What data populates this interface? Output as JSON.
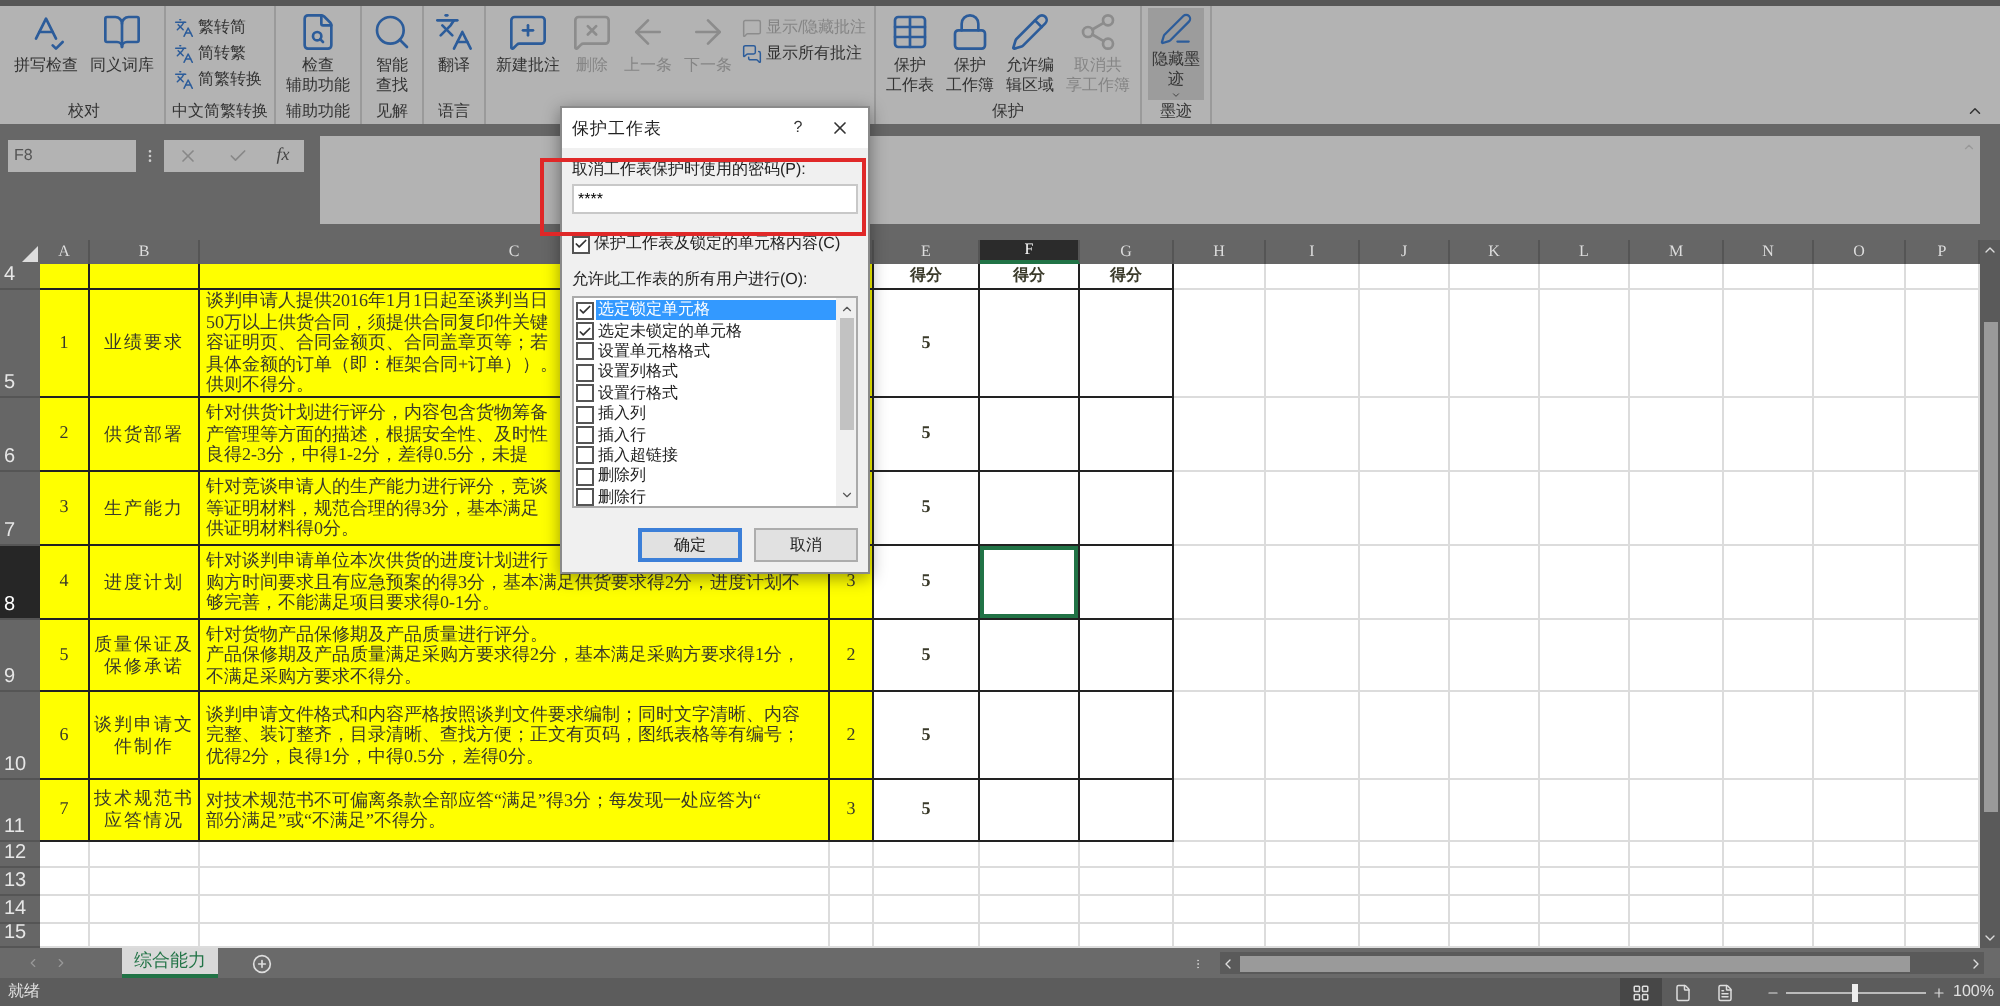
{
  "ribbon": {
    "groups": [
      {
        "label": "校对",
        "buttons": [
          {
            "lines": [
              "拼写检查"
            ],
            "kind": "large",
            "disabled": false
          },
          {
            "lines": [
              "同义词库"
            ],
            "kind": "large",
            "disabled": false
          }
        ]
      },
      {
        "label": "中文简繁转换",
        "buttons": [
          {
            "lines": [
              "繁转简"
            ],
            "kind": "small",
            "disabled": false
          },
          {
            "lines": [
              "简转繁"
            ],
            "kind": "small",
            "disabled": false
          },
          {
            "lines": [
              "简繁转换"
            ],
            "kind": "small",
            "disabled": false
          }
        ]
      },
      {
        "label": "辅助功能",
        "buttons": [
          {
            "lines": [
              "检查",
              "辅助功能"
            ],
            "kind": "large",
            "disabled": false
          }
        ]
      },
      {
        "label": "见解",
        "buttons": [
          {
            "lines": [
              "智能",
              "查找"
            ],
            "kind": "large",
            "disabled": false
          }
        ]
      },
      {
        "label": "语言",
        "buttons": [
          {
            "lines": [
              "翻译"
            ],
            "kind": "large",
            "disabled": false
          }
        ]
      },
      {
        "buttons": [
          {
            "lines": [
              "新建批注"
            ],
            "kind": "large",
            "disabled": false
          },
          {
            "lines": [
              "删除"
            ],
            "kind": "large",
            "disabled": true
          },
          {
            "lines": [
              "上一条"
            ],
            "kind": "large",
            "disabled": true
          },
          {
            "lines": [
              "下一条"
            ],
            "kind": "large",
            "disabled": true
          },
          {
            "lines": [
              "显示/隐藏批注"
            ],
            "kind": "small",
            "disabled": true
          },
          {
            "lines": [
              "显示所有批注"
            ],
            "kind": "small",
            "disabled": false
          }
        ]
      },
      {
        "label": "保护",
        "buttons": [
          {
            "lines": [
              "保护",
              "工作表"
            ],
            "kind": "large",
            "disabled": false
          },
          {
            "lines": [
              "保护",
              "工作簿"
            ],
            "kind": "large",
            "disabled": false
          },
          {
            "lines": [
              "允许编",
              "辑区域"
            ],
            "kind": "large",
            "disabled": false
          },
          {
            "lines": [
              "取消共",
              "享工作簿"
            ],
            "kind": "large",
            "disabled": true
          }
        ]
      },
      {
        "label": "墨迹",
        "buttons": [
          {
            "lines": [
              "隐藏墨",
              "迹"
            ],
            "kind": "toggle",
            "disabled": false
          }
        ]
      }
    ]
  },
  "formula_bar": {
    "name_box": "F8",
    "function_label": "fx"
  },
  "sheet": {
    "columns": [
      {
        "label": "A",
        "selected": false
      },
      {
        "label": "B",
        "selected": false
      },
      {
        "label": "C",
        "selected": false
      },
      {
        "selected": false
      },
      {
        "label": "E",
        "selected": false
      },
      {
        "label": "F",
        "selected": true
      },
      {
        "label": "G",
        "selected": false
      },
      {
        "label": "H",
        "selected": false
      },
      {
        "label": "I",
        "selected": false
      },
      {
        "label": "J",
        "selected": false
      },
      {
        "label": "K",
        "selected": false
      },
      {
        "label": "L",
        "selected": false
      },
      {
        "label": "M",
        "selected": false
      },
      {
        "label": "N",
        "selected": false
      },
      {
        "label": "O",
        "selected": false
      },
      {
        "label": "P",
        "selected": false
      }
    ],
    "rows": [
      {
        "number": "4",
        "selected": false,
        "highlighted": true,
        "cells": {
          "E": "得分",
          "F": "得分",
          "G": "得分"
        }
      },
      {
        "number": "5",
        "selected": false,
        "highlighted": true,
        "cells": {
          "A": "1",
          "B": "业绩要求",
          "C": [
            "谈判申请人提供2016年1月1日起至谈判当日",
            "50万以上供货合同，须提供合同复印件关键",
            "容证明页、合同金额页、合同盖章页等；若",
            "具体金额的订单（即：框架合同+订单））。",
            "供则不得分。"
          ],
          "E": "5"
        }
      },
      {
        "number": "6",
        "selected": false,
        "highlighted": true,
        "cells": {
          "A": "2",
          "B": "供货部署",
          "C": [
            "针对供货计划进行评分，内容包含货物筹备",
            "产管理等方面的描述，根据安全性、及时性",
            "良得2-3分，中得1-2分，差得0.5分，未提"
          ],
          "E": "5"
        }
      },
      {
        "number": "7",
        "selected": false,
        "highlighted": true,
        "cells": {
          "A": "3",
          "B": "生产能力",
          "C": [
            "针对竞谈申请人的生产能力进行评分，竞谈",
            "等证明材料，规范合理的得3分，基本满足",
            "供证明材料得0分。"
          ],
          "E": "5"
        }
      },
      {
        "number": "8",
        "selected": true,
        "highlighted": true,
        "cells": {
          "A": "4",
          "B": "进度计划",
          "C": [
            "针对谈判申请单位本次供货的进度计划进行",
            "购方时间要求且有应急预案的得3分，基本满足供货要求得2分，进度计划不",
            "够完善，不能满足项目要求得0-1分。"
          ],
          "D": "3",
          "E": "5"
        }
      },
      {
        "number": "9",
        "selected": false,
        "highlighted": true,
        "cells": {
          "A": "5",
          "B": "质量保证及保修承诺",
          "C": [
            "针对货物产品保修期及产品质量进行评分。",
            "产品保修期及产品质量满足采购方要求得2分，基本满足采购方要求得1分，",
            "不满足采购方要求不得分。"
          ],
          "D": "2",
          "E": "5"
        }
      },
      {
        "number": "10",
        "selected": false,
        "highlighted": true,
        "cells": {
          "A": "6",
          "B": "谈判申请文件制作",
          "C": [
            "谈判申请文件格式和内容严格按照谈判文件要求编制；同时文字清晰、内容",
            "完整、装订整齐，目录清晰、查找方便；正文有页码，图纸表格等有编号；",
            "优得2分，良得1分，中得0.5分，差得0分。"
          ],
          "D": "2",
          "E": "5"
        }
      },
      {
        "number": "11",
        "selected": false,
        "highlighted": true,
        "cells": {
          "A": "7",
          "B": "技术规范书应答情况",
          "C": [
            "对技术规范书不可偏离条款全部应答“满足”得3分；每发现一处应答为“",
            "部分满足”或“不满足”不得分。"
          ],
          "D": "3",
          "E": "5"
        }
      },
      {
        "number": "12",
        "selected": false,
        "highlighted": false
      },
      {
        "number": "13",
        "selected": false,
        "highlighted": false
      },
      {
        "number": "14",
        "selected": false,
        "highlighted": false
      },
      {
        "number": "15",
        "selected": false,
        "highlighted": false
      }
    ]
  },
  "sheet_tabs": [
    {
      "label": "综合能力",
      "selected": true
    }
  ],
  "dialog": {
    "title": "保护工作表",
    "help": "?",
    "password_label": "取消工作表保护时使用的密码(P):",
    "password": "****",
    "protect_option": {
      "label": "保护工作表及锁定的单元格内容(C)",
      "checked": true
    },
    "permissions_label": "允许此工作表的所有用户进行(O):",
    "permissions": [
      {
        "label": "选定锁定单元格",
        "checked": true,
        "selected": true
      },
      {
        "label": "选定未锁定的单元格",
        "checked": true,
        "selected": false
      },
      {
        "label": "设置单元格格式",
        "checked": false,
        "selected": false
      },
      {
        "label": "设置列格式",
        "checked": false,
        "selected": false
      },
      {
        "label": "设置行格式",
        "checked": false,
        "selected": false
      },
      {
        "label": "插入列",
        "checked": false,
        "selected": false
      },
      {
        "label": "插入行",
        "checked": false,
        "selected": false
      },
      {
        "label": "插入超链接",
        "checked": false,
        "selected": false
      },
      {
        "label": "删除列",
        "checked": false,
        "selected": false
      },
      {
        "label": "删除行",
        "checked": false,
        "selected": false
      }
    ],
    "buttons": [
      {
        "label": "确定",
        "default": true
      },
      {
        "label": "取消",
        "default": false
      }
    ]
  },
  "status_bar": {
    "status": "就绪",
    "views": [
      {
        "selected": true
      },
      {
        "selected": false
      },
      {
        "selected": false
      }
    ],
    "zoom": {
      "level": 0.5
    },
    "zoom_label": "100%"
  }
}
